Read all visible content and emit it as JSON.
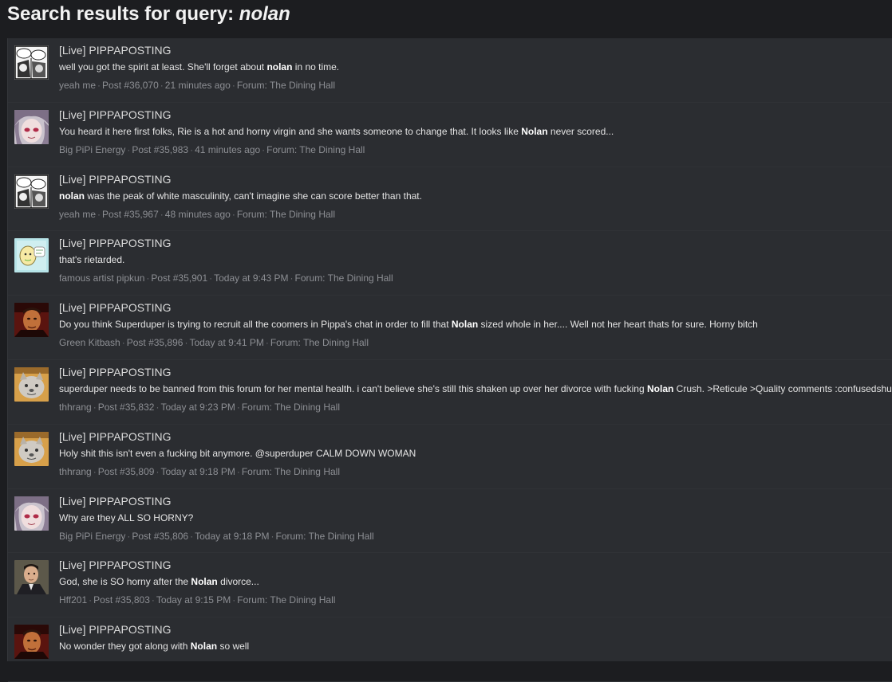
{
  "header": {
    "title_prefix": "Search results for query:",
    "query": "nolan"
  },
  "results": [
    {
      "avatar": "manga-panel-avatar",
      "title": "[Live] PIPPAPOSTING",
      "snippet_parts": [
        [
          "",
          "well you got the spirit at least. She'll forget about "
        ],
        [
          "b",
          "nolan"
        ],
        [
          "",
          " in no time."
        ]
      ],
      "author": "yeah me",
      "post": "Post #36,070",
      "time": "21 minutes ago",
      "forum": "Forum: The Dining Hall"
    },
    {
      "avatar": "anime-girl-avatar",
      "title": "[Live] PIPPAPOSTING",
      "snippet_parts": [
        [
          "",
          "You heard it here first folks, Rie is a hot and horny virgin and she wants someone to change that. It looks like "
        ],
        [
          "b",
          "Nolan"
        ],
        [
          "",
          " never scored..."
        ]
      ],
      "author": "Big PiPi Energy",
      "post": "Post #35,983",
      "time": "41 minutes ago",
      "forum": "Forum: The Dining Hall"
    },
    {
      "avatar": "manga-panel-avatar",
      "title": "[Live] PIPPAPOSTING",
      "snippet_parts": [
        [
          "b",
          "nolan"
        ],
        [
          "",
          " was the peak of white masculinity, can't imagine she can score better than that."
        ]
      ],
      "author": "yeah me",
      "post": "Post #35,967",
      "time": "48 minutes ago",
      "forum": "Forum: The Dining Hall"
    },
    {
      "avatar": "doodle-avatar",
      "title": "[Live] PIPPAPOSTING",
      "snippet_parts": [
        [
          "",
          "that's rietarded."
        ]
      ],
      "author": "famous artist pipkun",
      "post": "Post #35,901",
      "time": "Today at 9:43 PM",
      "forum": "Forum: The Dining Hall"
    },
    {
      "avatar": "man-red-avatar",
      "title": "[Live] PIPPAPOSTING",
      "snippet_parts": [
        [
          "",
          "Do you think Superduper is trying to recruit all the coomers in Pippa's chat in order to fill that "
        ],
        [
          "b",
          "Nolan"
        ],
        [
          "",
          " sized whole in her.... Well not her heart thats for sure. Horny bitch"
        ]
      ],
      "author": "Green Kitbash",
      "post": "Post #35,896",
      "time": "Today at 9:41 PM",
      "forum": "Forum: The Dining Hall"
    },
    {
      "avatar": "shiba-avatar",
      "title": "[Live] PIPPAPOSTING",
      "snippet_parts": [
        [
          "",
          "superduper needs to be banned from this forum for her mental health. i can't believe she's still this shaken up over her divorce with fucking "
        ],
        [
          "b",
          "Nolan"
        ],
        [
          "",
          " Crush. >Reticule >Quality comments :confusedshuba:"
        ]
      ],
      "author": "thhrang",
      "post": "Post #35,832",
      "time": "Today at 9:23 PM",
      "forum": "Forum: The Dining Hall"
    },
    {
      "avatar": "shiba-avatar",
      "title": "[Live] PIPPAPOSTING",
      "snippet_parts": [
        [
          "",
          "Holy shit this isn't even a fucking bit anymore. @superduper CALM DOWN WOMAN"
        ]
      ],
      "author": "thhrang",
      "post": "Post #35,809",
      "time": "Today at 9:18 PM",
      "forum": "Forum: The Dining Hall"
    },
    {
      "avatar": "anime-girl-avatar",
      "title": "[Live] PIPPAPOSTING",
      "snippet_parts": [
        [
          "",
          "Why are they ALL SO HORNY?"
        ]
      ],
      "author": "Big PiPi Energy",
      "post": "Post #35,806",
      "time": "Today at 9:18 PM",
      "forum": "Forum: The Dining Hall"
    },
    {
      "avatar": "man-suit-avatar",
      "title": "[Live] PIPPAPOSTING",
      "snippet_parts": [
        [
          "",
          "God, she is SO horny after the "
        ],
        [
          "b",
          "Nolan"
        ],
        [
          "",
          " divorce..."
        ]
      ],
      "author": "Hff201",
      "post": "Post #35,803",
      "time": "Today at 9:15 PM",
      "forum": "Forum: The Dining Hall"
    },
    {
      "avatar": "man-red-avatar",
      "title": "[Live] PIPPAPOSTING",
      "snippet_parts": [
        [
          "",
          "No wonder they got along with "
        ],
        [
          "b",
          "Nolan"
        ],
        [
          "",
          " so well"
        ]
      ],
      "author": "",
      "post": "",
      "time": "",
      "forum": ""
    }
  ]
}
